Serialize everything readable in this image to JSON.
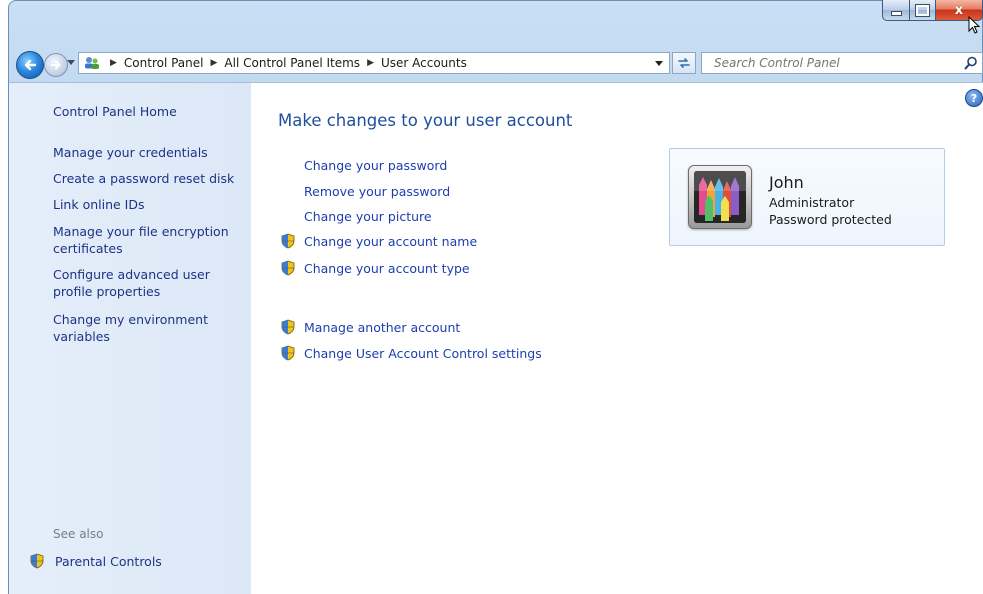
{
  "window": {
    "caption": {
      "minimize": "minimize",
      "maximize": "maximize",
      "close": "x"
    }
  },
  "nav": {
    "breadcrumbs": [
      "Control Panel",
      "All Control Panel Items",
      "User Accounts"
    ],
    "search_placeholder": "Search Control Panel"
  },
  "sidebar": {
    "items": [
      "Control Panel Home",
      "Manage your credentials",
      "Create a password reset disk",
      "Link online IDs",
      "Manage your file encryption certificates",
      "Configure advanced user profile properties",
      "Change my environment variables"
    ],
    "see_also": "See also",
    "see_also_items": [
      "Parental Controls"
    ]
  },
  "main": {
    "title": "Make changes to your user account",
    "tasks": [
      {
        "label": "Change your password",
        "shield": false
      },
      {
        "label": "Remove your password",
        "shield": false
      },
      {
        "label": "Change your picture",
        "shield": false
      },
      {
        "label": "Change your account name",
        "shield": true
      },
      {
        "label": "Change your account type",
        "shield": true
      }
    ],
    "other_tasks": [
      {
        "label": "Manage another account",
        "shield": true
      },
      {
        "label": "Change User Account Control settings",
        "shield": true
      }
    ]
  },
  "account": {
    "name": "John",
    "role": "Administrator",
    "status": "Password protected"
  },
  "icons": {
    "back": "back-arrow-icon",
    "forward": "forward-arrow-icon",
    "refresh": "refresh-icon",
    "search": "search-icon",
    "shield": "uac-shield-icon",
    "help": "help-icon",
    "address": "user-accounts-icon"
  },
  "colors": {
    "link": "#1e3eb0",
    "sidebar_bg": "#e5eefa",
    "title": "#1e4e9c",
    "chrome": "#b5d0ec"
  }
}
